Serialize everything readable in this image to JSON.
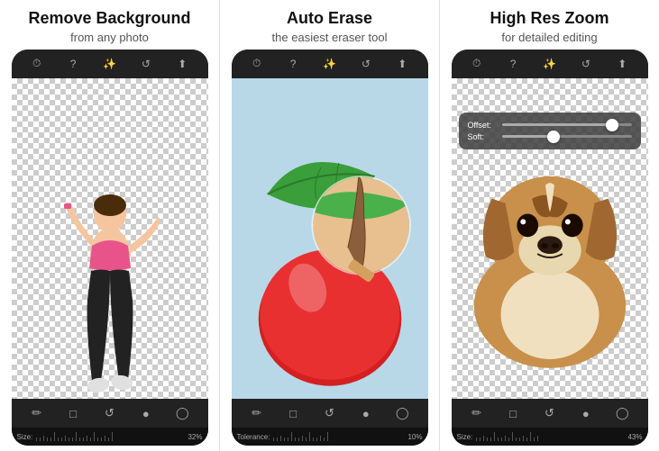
{
  "panels": [
    {
      "id": "remove-bg",
      "title": "Remove Background",
      "subtitle": "from any photo",
      "topbar_icons": [
        "clock",
        "question",
        "wand",
        "rotate",
        "share"
      ],
      "bottom_icons": [
        "pencil",
        "eraser",
        "rotate-left",
        "camera",
        "eye"
      ],
      "ruler_label": "Size:",
      "ruler_value": "32%",
      "zoom_overlay": null
    },
    {
      "id": "auto-erase",
      "title": "Auto Erase",
      "subtitle": "the easiest eraser tool",
      "topbar_icons": [
        "clock",
        "question",
        "wand",
        "rotate",
        "share"
      ],
      "bottom_icons": [
        "pencil",
        "eraser",
        "rotate-left",
        "camera",
        "eye"
      ],
      "ruler_label": "Tolerance:",
      "ruler_value": "10%",
      "zoom_overlay": null
    },
    {
      "id": "high-res-zoom",
      "title": "High Res Zoom",
      "subtitle": "for detailed editing",
      "topbar_icons": [
        "clock",
        "question",
        "wand",
        "rotate",
        "share"
      ],
      "bottom_icons": [
        "pencil",
        "eraser",
        "rotate-left",
        "camera",
        "eye"
      ],
      "ruler_label": "Size:",
      "ruler_value": "43%",
      "zoom_overlay": {
        "offset_label": "Offset:",
        "offset_fill_pct": 85,
        "soft_label": "Soft:",
        "soft_fill_pct": 40
      }
    }
  ]
}
